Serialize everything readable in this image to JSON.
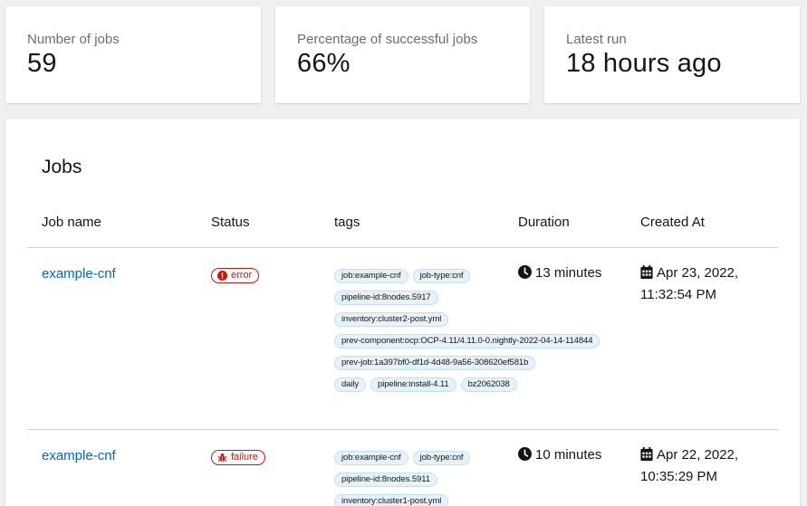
{
  "stats": [
    {
      "label": "Number of jobs",
      "value": "59"
    },
    {
      "label": "Percentage of successful jobs",
      "value": "66%"
    },
    {
      "label": "Latest run",
      "value": "18 hours ago"
    }
  ],
  "jobs": {
    "title": "Jobs",
    "columns": [
      "Job name",
      "Status",
      "tags",
      "Duration",
      "Created At"
    ],
    "rows": [
      {
        "name": "example-cnf",
        "status": "error",
        "status_icon": "exclamation-circle-icon",
        "tags": [
          "job:example-cnf",
          "job-type:cnf",
          "pipeline-id:8nodes.5917",
          "inventory:cluster2-post.yml",
          "prev-component:ocp:OCP-4.11/4.11.0-0.nightly-2022-04-14-114844",
          "prev-job:1a397bf0-df1d-4d48-9a56-308620ef581b",
          "daily",
          "pipeline:install-4.11",
          "bz2062038"
        ],
        "duration": "13 minutes",
        "created": "Apr 23, 2022, 11:32:54 PM"
      },
      {
        "name": "example-cnf",
        "status": "failure",
        "status_icon": "bug-icon",
        "tags": [
          "job:example-cnf",
          "job-type:cnf",
          "pipeline-id:8nodes.5911",
          "inventory:cluster1-post.yml"
        ],
        "duration": "10 minutes",
        "created": "Apr 22, 2022, 10:35:29 PM"
      }
    ]
  },
  "colors": {
    "link": "#0066cc",
    "danger": "#c9190b",
    "tag_bg": "#e7f1fa"
  }
}
